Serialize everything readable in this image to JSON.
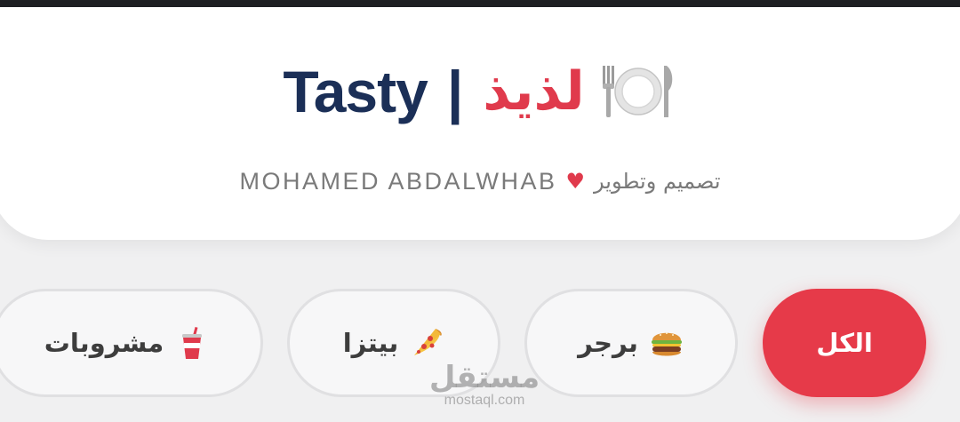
{
  "header": {
    "brand_en": "Tasty",
    "separator": "|",
    "brand_ar": "لذيذ",
    "brand_icon": "plate-with-cutlery-icon",
    "credit_name": "MOHAMED ABDALWHAB",
    "credit_symbol": "♥",
    "credit_ar": "تصميم وتطوير"
  },
  "categories": [
    {
      "label": "الكل",
      "icon": "",
      "active": true
    },
    {
      "label": "برجر",
      "icon": "burger-icon",
      "active": false
    },
    {
      "label": "بيتزا",
      "icon": "pizza-icon",
      "active": false
    },
    {
      "label": "مشروبات",
      "icon": "cup-with-straw-icon",
      "active": false
    }
  ],
  "watermark": {
    "ar": "مستقل",
    "en": "mostaql.com"
  },
  "colors": {
    "accent": "#e63a49",
    "brand_navy": "#1b2f57",
    "background": "#f0f0f1"
  }
}
